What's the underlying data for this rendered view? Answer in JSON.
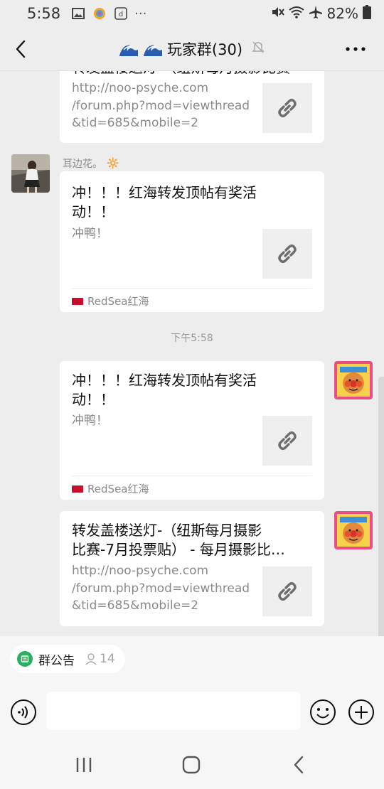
{
  "status": {
    "time": "5:58",
    "battery": "82%",
    "more": "···"
  },
  "header": {
    "title": "玩家群(30)",
    "more": "···"
  },
  "messages": [
    {
      "partial_title": "转发盖楼送灯-（纽斯每月摄影比赛",
      "desc_lines": [
        "http://noo-psyche.com",
        "/forum.php?mod=viewthread",
        "&tid=685&mobile=2"
      ]
    },
    {
      "sender": "耳边花。",
      "sender_emoji": "🔆",
      "title_lines": [
        "冲！！！红海转发顶帖有奖活",
        "动！！"
      ],
      "desc": "冲鸭！",
      "source": "RedSea红海"
    },
    {
      "timestamp": "下午5:58"
    },
    {
      "title_lines": [
        "冲！！！红海转发顶帖有奖活",
        "动！！"
      ],
      "desc": "冲鸭！",
      "source": "RedSea红海"
    },
    {
      "title_lines": [
        "转发盖楼送灯-（纽斯每月摄影",
        "比赛-7月投票贴） - 每月摄影比…"
      ],
      "desc_lines": [
        "http://noo-psyche.com",
        "/forum.php?mod=viewthread",
        "&tid=685&mobile=2"
      ]
    }
  ],
  "notice": {
    "label": "群公告",
    "count": "14"
  },
  "input": {
    "value": ""
  },
  "colors": {
    "background": "#ededed",
    "bubble": "#ffffff",
    "notice_green": "#29b05e",
    "muted_text": "#8a8a8a"
  }
}
